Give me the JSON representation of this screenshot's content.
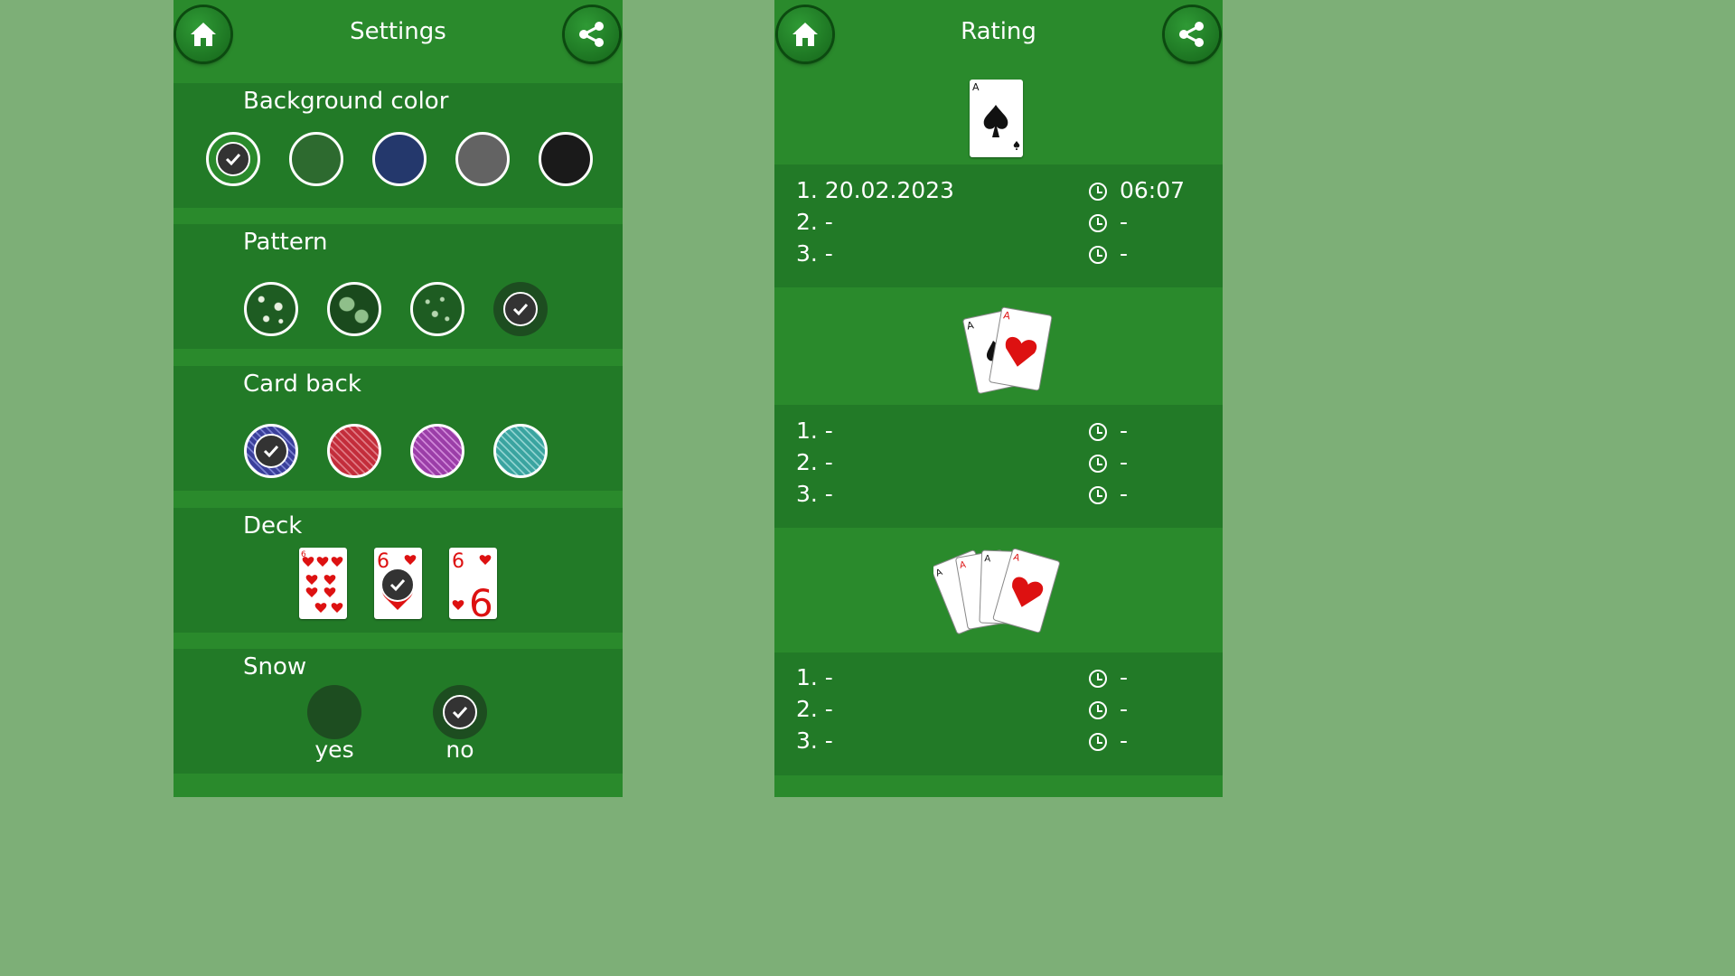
{
  "settings": {
    "title": "Settings",
    "home_icon": "home-icon",
    "share_icon": "share-icon",
    "background_color": {
      "label": "Background color",
      "swatches": [
        "#2a8a2c",
        "#2d6a2f",
        "#24386c",
        "#636363",
        "#1a1a1a"
      ],
      "selected_index": 0
    },
    "pattern": {
      "label": "Pattern",
      "selected_index": 3
    },
    "card_back": {
      "label": "Card back",
      "colors": [
        "#3a3f9a",
        "#c32d3b",
        "#9b3ea8",
        "#3aa4a0"
      ],
      "selected_index": 0
    },
    "deck": {
      "label": "Deck",
      "selected_index": 1,
      "card_rank": "6"
    },
    "snow": {
      "label": "Snow",
      "options": [
        "yes",
        "no"
      ],
      "selected_index": 1
    }
  },
  "rating": {
    "title": "Rating",
    "card_label": "A",
    "groups": [
      {
        "rows": [
          {
            "place": "1. 20.02.2023",
            "time": "06:07"
          },
          {
            "place": "2. -",
            "time": "-"
          },
          {
            "place": "3. -",
            "time": "-"
          }
        ]
      },
      {
        "rows": [
          {
            "place": "1. -",
            "time": "-"
          },
          {
            "place": "2. -",
            "time": "-"
          },
          {
            "place": "3. -",
            "time": "-"
          }
        ]
      },
      {
        "rows": [
          {
            "place": "1. -",
            "time": "-"
          },
          {
            "place": "2. -",
            "time": "-"
          },
          {
            "place": "3. -",
            "time": "-"
          }
        ]
      }
    ]
  }
}
